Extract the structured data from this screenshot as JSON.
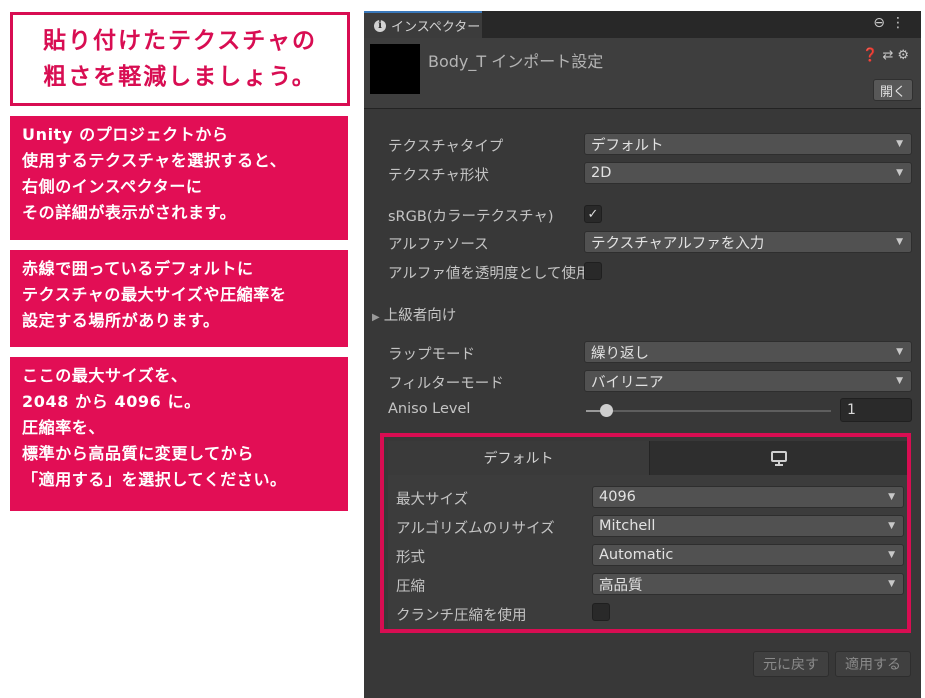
{
  "annotations": {
    "title": "貼り付けたテクスチャの\n粗さを軽減しましょう。",
    "notes": [
      "Unity のプロジェクトから\n使用するテクスチャを選択すると、\n右側のインスペクターに\nその詳細が表示がされます。",
      "赤線で囲っているデフォルトに\nテクスチャの最大サイズや圧縮率を\n設定する場所があります。",
      "ここの最大サイズを、\n2048 から 4096 に。\n圧縮率を、\n標準から高品質に変更してから\n「適用する」を選択してください。"
    ]
  },
  "inspector": {
    "tab_label": "インスペクター",
    "asset_title": "Body_T インポート設定",
    "open_button": "開く",
    "fields": {
      "texture_type": {
        "label": "テクスチャタイプ",
        "value": "デフォルト"
      },
      "texture_shape": {
        "label": "テクスチャ形状",
        "value": "2D"
      },
      "srgb": {
        "label": "sRGB(カラーテクスチャ)",
        "checked": true
      },
      "alpha_source": {
        "label": "アルファソース",
        "value": "テクスチャアルファを入力"
      },
      "alpha_is_transparency": {
        "label": "アルファ値を透明度として使用",
        "checked": false
      },
      "advanced": {
        "label": "上級者向け"
      },
      "wrap_mode": {
        "label": "ラップモード",
        "value": "繰り返し"
      },
      "filter_mode": {
        "label": "フィルターモード",
        "value": "バイリニア"
      },
      "aniso_level": {
        "label": "Aniso Level",
        "value": "1"
      }
    },
    "platform": {
      "default_tab": "デフォルト",
      "max_size": {
        "label": "最大サイズ",
        "value": "4096"
      },
      "resize_algorithm": {
        "label": "アルゴリズムのリサイズ",
        "value": "Mitchell"
      },
      "format": {
        "label": "形式",
        "value": "Automatic"
      },
      "compression": {
        "label": "圧縮",
        "value": "高品質"
      },
      "crunch": {
        "label": "クランチ圧縮を使用",
        "checked": false
      }
    },
    "footer": {
      "revert": "元に戻す",
      "apply": "適用する"
    }
  },
  "colors": {
    "accent": "#e20e55",
    "panel": "#383838"
  }
}
